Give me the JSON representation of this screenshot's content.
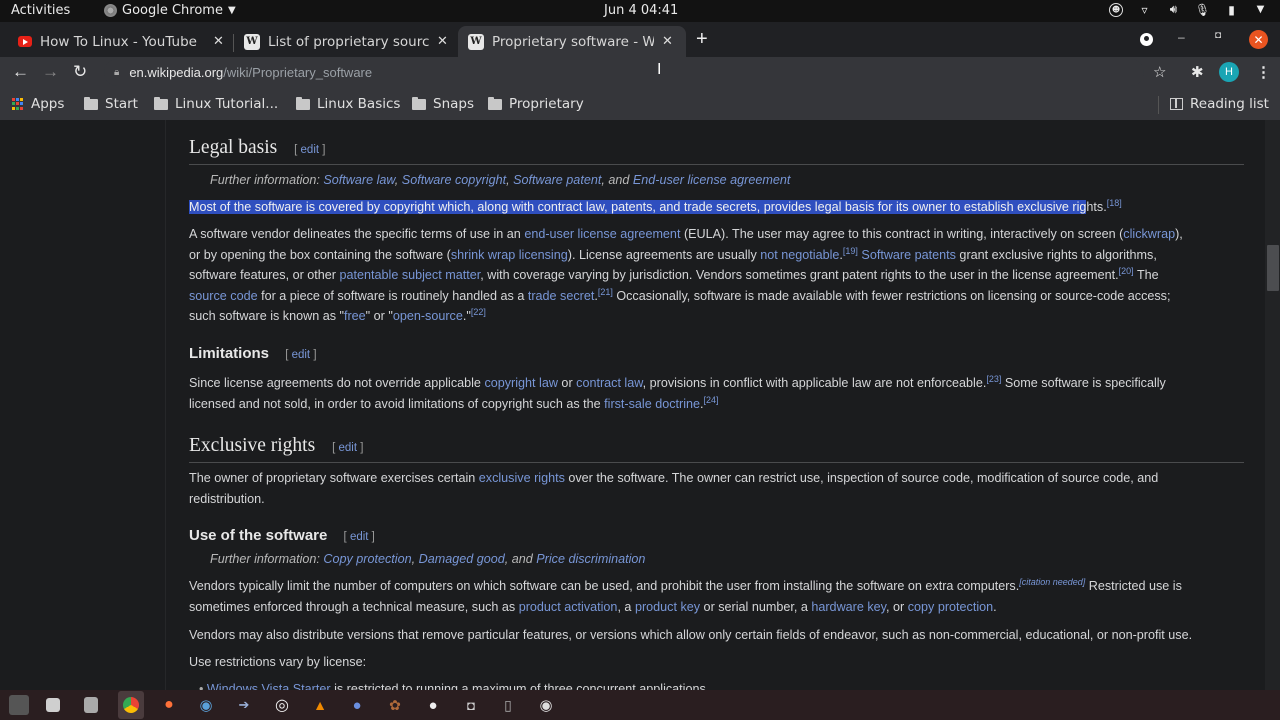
{
  "system_bar": {
    "activities": "Activities",
    "app_name": "Google Chrome",
    "clock": "Jun 4  04:41"
  },
  "tabs": [
    {
      "title": "How To Linux - YouTube",
      "favicon": "youtube-icon",
      "active": false
    },
    {
      "title": "List of proprietary source",
      "favicon": "wikipedia-icon",
      "active": false
    },
    {
      "title": "Proprietary software - Wi",
      "favicon": "wikipedia-icon",
      "active": true
    }
  ],
  "toolbar": {
    "url_host": "en.wikipedia.org",
    "url_path": "/wiki/Proprietary_software",
    "avatar_letter": "H"
  },
  "bookmarks": {
    "items": [
      "Apps",
      "Start",
      "Linux Tutorial...",
      "Linux Basics",
      "Snaps",
      "Proprietary"
    ],
    "reading_list": "Reading list"
  },
  "article": {
    "edit_label": "edit",
    "legal_basis": {
      "heading": "Legal basis",
      "hatnote_prefix": "Further information: ",
      "hatnote_links": [
        "Software law",
        "Software copyright",
        "Software patent",
        "End-user license agreement"
      ],
      "p1_selected": "Most of the software is covered by copyright which, along with contract law, patents, and trade secrets, provides legal basis for its owner to establish exclusive rig",
      "p1_rest": "hts.",
      "p1_ref": "[18]",
      "p2": {
        "t1": "A software vendor delineates the specific terms of use in an ",
        "l1": "end-user license agreement",
        "t2": " (EULA). The user may agree to this contract in writing, interactively on screen (",
        "l2": "clickwrap",
        "t3": "),",
        "t4": "or by opening the box containing the software (",
        "l3": "shrink wrap licensing",
        "t5": "). License agreements are usually ",
        "l4": "not negotiable",
        "t6": ".",
        "r1": "[19]",
        "l5": "Software patents",
        "t7": " grant exclusive rights to algorithms,",
        "t8": "software features, or other ",
        "l6": "patentable subject matter",
        "t9": ", with coverage varying by jurisdiction. Vendors sometimes grant patent rights to the user in the license agreement.",
        "r2": "[20]",
        "t10": " The",
        "l7": "source code",
        "t11": " for a piece of software is routinely handled as a ",
        "l8": "trade secret",
        "t12": ".",
        "r3": "[21]",
        "t13": " Occasionally, software is made available with fewer restrictions on licensing or source-code access;",
        "t14": "such software is known as \"",
        "l9": "free",
        "t15": "\" or \"",
        "l10": "open-source",
        "t16": ".\"",
        "r4": "[22]"
      }
    },
    "limitations": {
      "heading": "Limitations",
      "t1": "Since license agreements do not override applicable ",
      "l1": "copyright law",
      "t2": " or ",
      "l2": "contract law",
      "t3": ", provisions in conflict with applicable law are not enforceable.",
      "r1": "[23]",
      "t4": " Some software is specifically",
      "t5": "licensed and not sold, in order to avoid limitations of copyright such as the ",
      "l3": "first-sale doctrine",
      "t6": ".",
      "r2": "[24]"
    },
    "exclusive_rights": {
      "heading": "Exclusive rights",
      "t1": "The owner of proprietary software exercises certain ",
      "l1": "exclusive rights",
      "t2": " over the software. The owner can restrict use, inspection of source code, modification of source code, and",
      "t3": "redistribution."
    },
    "use_of_software": {
      "heading": "Use of the software",
      "hatnote_prefix": "Further information: ",
      "hatnote_links": [
        "Copy protection",
        "Damaged good",
        "Price discrimination"
      ],
      "p1": {
        "t1": "Vendors typically limit the number of computers on which software can be used, and prohibit the user from installing the software on extra computers.",
        "r1": "[citation needed]",
        "t2": " Restricted use is",
        "t3": "sometimes enforced through a technical measure, such as ",
        "l1": "product activation",
        "t4": ", a ",
        "l2": "product key",
        "t5": " or serial number, a ",
        "l3": "hardware key",
        "t6": ", or ",
        "l4": "copy protection",
        "t7": "."
      },
      "p2": "Vendors may also distribute versions that remove particular features, or versions which allow only certain fields of endeavor, such as non-commercial, educational, or non-profit use.",
      "p3": "Use restrictions vary by license:",
      "list_item_link": "Windows Vista Starter",
      "list_item_text": " is restricted to running a maximum of three concurrent applications."
    }
  },
  "dock": [
    "terminal",
    "files",
    "disk-utility",
    "google-chrome",
    "firefox",
    "steam",
    "mixer",
    "obs-studio",
    "vlc",
    "password-manager",
    "gimp",
    "vscode",
    "screenshot",
    "usb-creator",
    "disc"
  ]
}
